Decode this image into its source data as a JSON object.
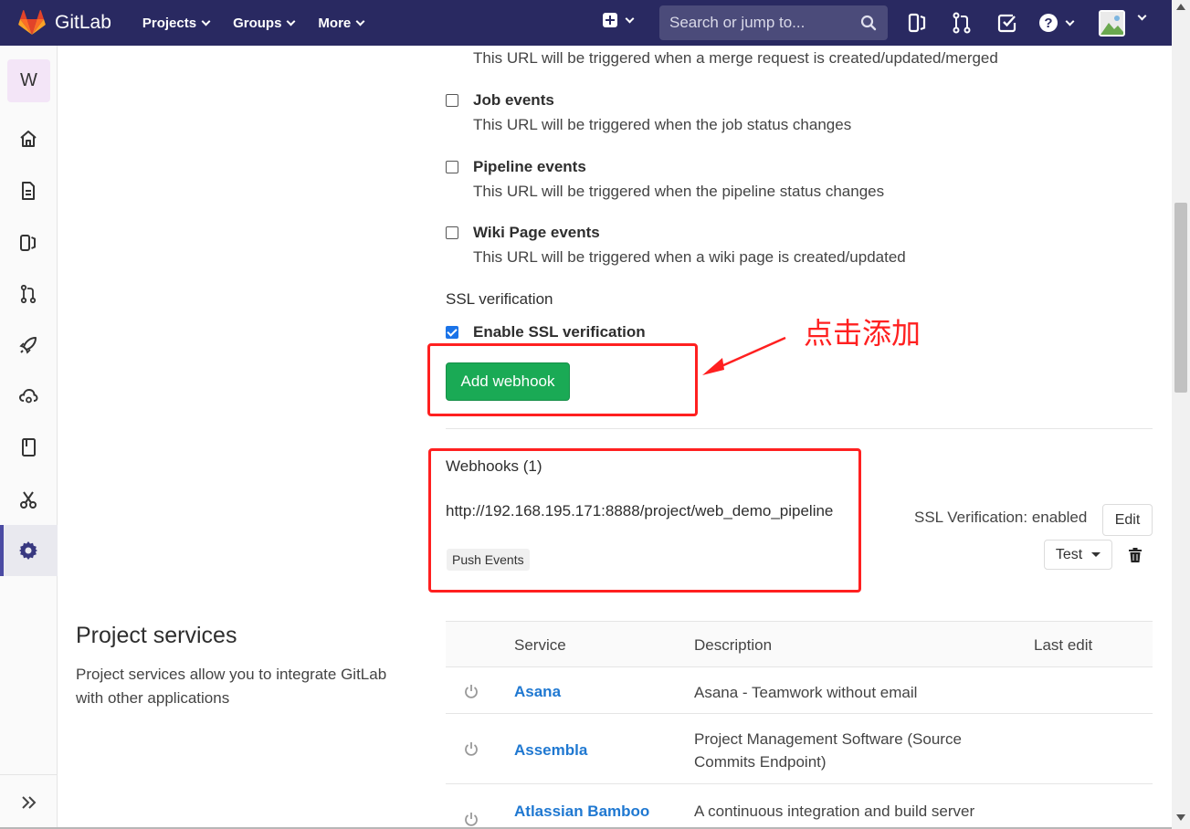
{
  "colors": {
    "navbar": "#292961",
    "accent_green": "#1aaa55",
    "link_blue": "#1f78d1",
    "annotation_red": "#ff2020"
  },
  "navbar": {
    "brand": "GitLab",
    "menu": [
      "Projects",
      "Groups",
      "More"
    ],
    "search_placeholder": "Search or jump to...",
    "icons": [
      "plus-icon",
      "search-icon",
      "issues-icon",
      "merge-requests-icon",
      "todos-icon",
      "help-icon",
      "user-avatar"
    ]
  },
  "sidebar": {
    "project_initial": "W",
    "items": [
      "home-icon",
      "repository-icon",
      "issues-icon",
      "merge-requests-icon",
      "ci-cd-icon",
      "operations-icon",
      "wiki-icon",
      "snippets-icon",
      "settings-icon"
    ],
    "active": "settings-icon"
  },
  "top_text": "This URL will be triggered when a merge request is created/updated/merged",
  "events": [
    {
      "title": "Job events",
      "desc": "This URL will be triggered when the job status changes",
      "checked": false
    },
    {
      "title": "Pipeline events",
      "desc": "This URL will be triggered when the pipeline status changes",
      "checked": false
    },
    {
      "title": "Wiki Page events",
      "desc": "This URL will be triggered when a wiki page is created/updated",
      "checked": false
    }
  ],
  "ssl": {
    "heading": "SSL verification",
    "label": "Enable SSL verification",
    "checked": true
  },
  "add_button": "Add webhook",
  "annotation": "点击添加",
  "webhooks": {
    "title": "Webhooks (1)",
    "url": "http://192.168.195.171:8888/project/web_demo_pipeline",
    "badge": "Push Events",
    "ssl_status": "SSL Verification: enabled",
    "edit_label": "Edit",
    "test_label": "Test"
  },
  "project_services": {
    "title": "Project services",
    "desc": "Project services allow you to integrate GitLab with other applications",
    "columns": [
      "Service",
      "Description",
      "Last edit"
    ],
    "rows": [
      {
        "name": "Asana",
        "desc": "Asana - Teamwork without email"
      },
      {
        "name": "Assembla",
        "desc": "Project Management Software (Source Commits Endpoint)"
      },
      {
        "name": "Atlassian Bamboo CI",
        "desc": "A continuous integration and build server"
      }
    ]
  }
}
